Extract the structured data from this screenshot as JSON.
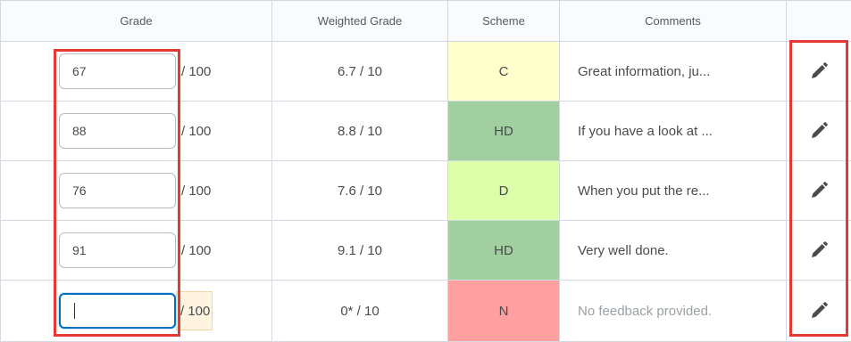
{
  "headers": {
    "grade": "Grade",
    "weighted": "Weighted Grade",
    "scheme": "Scheme",
    "comments": "Comments"
  },
  "colors": {
    "scheme_C": "#ffffcc",
    "scheme_HD": "#a1cf9f",
    "scheme_D": "#ddffaa",
    "scheme_N": "#ff9f9f",
    "annotation_red": "#e53935",
    "focus_blue": "#006fbf"
  },
  "rows": [
    {
      "grade": "67",
      "out_of": "/ 100",
      "weighted": "6.7 / 10",
      "scheme": "C",
      "scheme_color": "#ffffcc",
      "comment": "Great information, ju...",
      "edit_icon": "pencil-icon"
    },
    {
      "grade": "88",
      "out_of": "/ 100",
      "weighted": "8.8 / 10",
      "scheme": "HD",
      "scheme_color": "#a1cf9f",
      "comment": "If you have a look at ...",
      "edit_icon": "pencil-icon"
    },
    {
      "grade": "76",
      "out_of": "/ 100",
      "weighted": "7.6 / 10",
      "scheme": "D",
      "scheme_color": "#ddffaa",
      "comment": "When you put the re...",
      "edit_icon": "pencil-icon"
    },
    {
      "grade": "91",
      "out_of": "/ 100",
      "weighted": "9.1 / 10",
      "scheme": "HD",
      "scheme_color": "#a1cf9f",
      "comment": "Very well done.",
      "edit_icon": "pencil-icon"
    },
    {
      "grade": "",
      "out_of": "/ 100",
      "weighted": "0* / 10",
      "scheme": "N",
      "scheme_color": "#ff9f9f",
      "comment": "No feedback provided.",
      "edit_icon": "pencil-icon"
    }
  ]
}
